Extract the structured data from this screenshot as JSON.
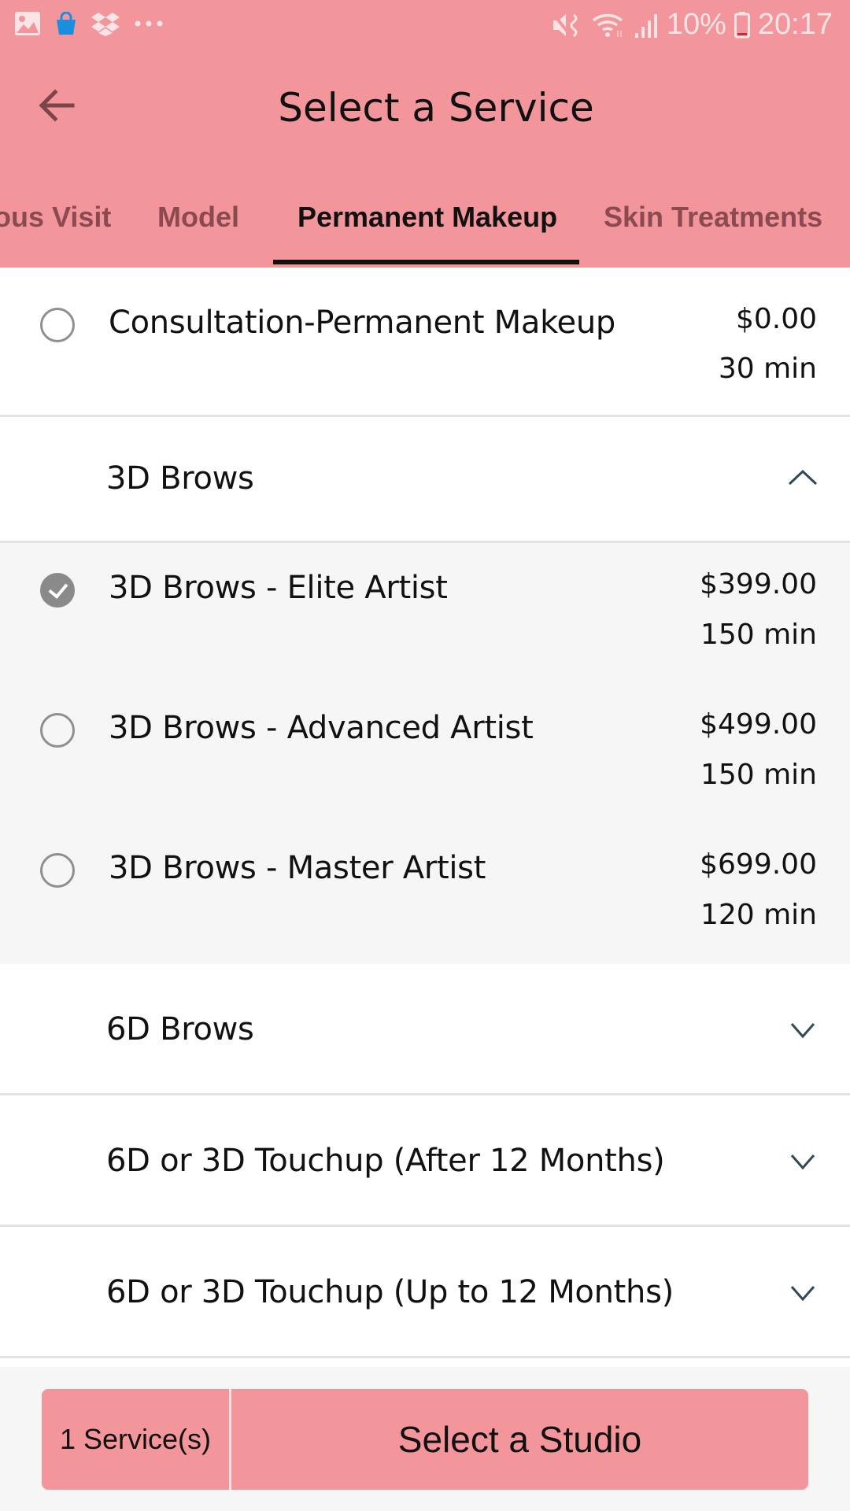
{
  "status_bar": {
    "left_icons": [
      "gallery-icon",
      "shopping-bag-icon",
      "dropbox-icon",
      "more-notifications-icon"
    ],
    "right_icons": [
      "mute-icon",
      "wifi-icon",
      "signal-icon",
      "battery-icon"
    ],
    "battery": "10%",
    "time": "20:17"
  },
  "header": {
    "title": "Select a Service",
    "back_icon": "arrow-left-icon"
  },
  "tabs": [
    {
      "label": "Previous Visit",
      "visible_label": "ous Visit",
      "active": false
    },
    {
      "label": "Model",
      "active": false
    },
    {
      "label": "Permanent Makeup",
      "active": true
    },
    {
      "label": "Skin Treatments",
      "active": false
    }
  ],
  "services": {
    "consultation": {
      "name": "Consultation-Permanent Makeup",
      "price": "$0.00",
      "duration": "30 min",
      "selected": false
    },
    "groups": [
      {
        "name": "3D Brows",
        "expanded": true,
        "items": [
          {
            "name": "3D Brows - Elite Artist",
            "price": "$399.00",
            "duration": "150 min",
            "selected": true
          },
          {
            "name": "3D Brows - Advanced Artist",
            "price": "$499.00",
            "duration": "150 min",
            "selected": false
          },
          {
            "name": "3D Brows - Master Artist",
            "price": "$699.00",
            "duration": "120 min",
            "selected": false
          }
        ]
      },
      {
        "name": "6D Brows",
        "expanded": false
      },
      {
        "name": "6D or 3D Touchup (After 12 Months)",
        "expanded": false
      },
      {
        "name": "6D or 3D Touchup (Up to 12 Months)",
        "expanded": false
      }
    ]
  },
  "footer": {
    "service_count": "1 Service(s)",
    "cta_label": "Select a Studio"
  },
  "colors": {
    "brand": "#f2969c",
    "inactive_tab": "#8a4a50",
    "chevron": "#2e4a58",
    "expanded_bg": "#f6f6f6"
  }
}
